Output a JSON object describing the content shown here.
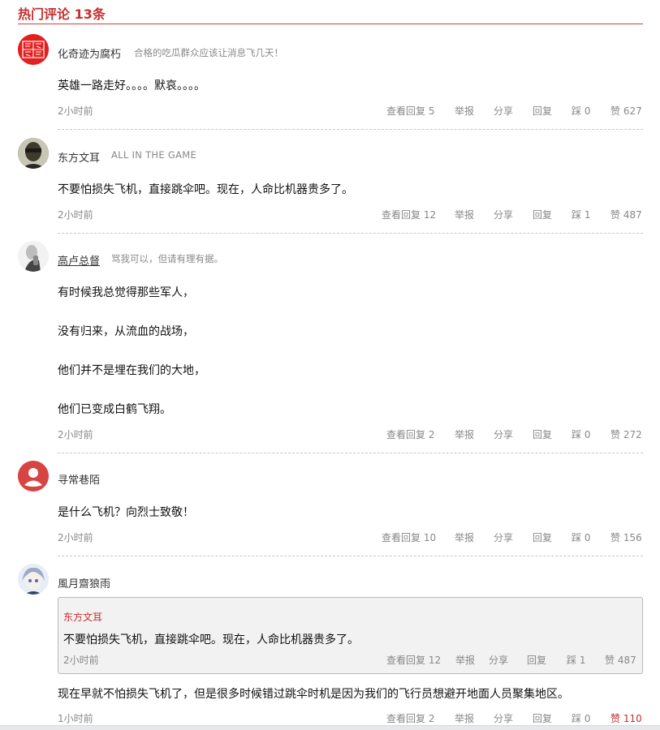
{
  "header": {
    "title": "热门评论 13条"
  },
  "labels": {
    "reply": "回复",
    "report": "举报",
    "share": "分享"
  },
  "comments": [
    {
      "user": "化奇迹为腐朽",
      "signature": "合格的吃瓜群众应该让消息飞几天！",
      "lines": [
        "英雄一路走好。。。。默哀。。。。"
      ],
      "time": "2小时前",
      "view_replies": "查看回复 5",
      "bury": "踩 0",
      "like": "赞 627"
    },
    {
      "user": "东方文耳",
      "signature": "ALL IN THE GAME",
      "lines": [
        "不要怕损失飞机，直接跳伞吧。现在，人命比机器贵多了。"
      ],
      "time": "2小时前",
      "view_replies": "查看回复 12",
      "bury": "踩 1",
      "like": "赞 487"
    },
    {
      "user": "高卢总督",
      "signature": "骂我可以，但请有理有据。",
      "lines": [
        "有时候我总觉得那些军人，",
        "没有归来，从流血的战场，",
        "他们并不是埋在我们的大地，",
        "他们已变成白鹤飞翔。"
      ],
      "time": "2小时前",
      "view_replies": "查看回复 2",
      "bury": "踩 0",
      "like": "赞 272"
    },
    {
      "user": "寻常巷陌",
      "signature": "",
      "lines": [
        "是什么飞机？向烈士致敬！"
      ],
      "time": "2小时前",
      "view_replies": "查看回复 10",
      "bury": "踩 0",
      "like": "赞 156"
    },
    {
      "user": "風月齋狼雨",
      "signature": "",
      "quote": {
        "user": "东方文耳",
        "body": "不要怕损失飞机，直接跳伞吧。现在，人命比机器贵多了。",
        "time": "2小时前",
        "view_replies": "查看回复 12",
        "bury": "踩 1",
        "like": "赞 487"
      },
      "lines": [
        "现在早就不怕损失飞机了，但是很多时候错过跳伞时机是因为我们的飞行员想避开地面人员聚集地区。"
      ],
      "time": "1小时前",
      "view_replies": "查看回复 2",
      "bury": "踩 0",
      "like": "赞 110"
    }
  ],
  "colors": {
    "accent": "#c62f2f",
    "muted": "#888888"
  }
}
